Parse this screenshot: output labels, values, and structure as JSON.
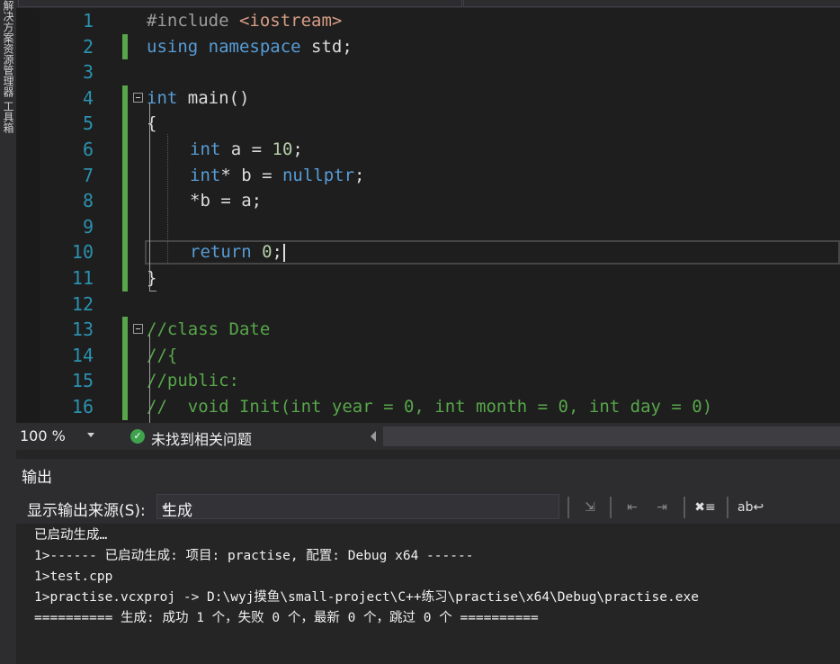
{
  "window": {
    "left_strip_text": "解决方案资源管理器 工具箱"
  },
  "editor": {
    "lines": [
      {
        "n": "1"
      },
      {
        "n": "2"
      },
      {
        "n": "3"
      },
      {
        "n": "4"
      },
      {
        "n": "5"
      },
      {
        "n": "6"
      },
      {
        "n": "7"
      },
      {
        "n": "8"
      },
      {
        "n": "9"
      },
      {
        "n": "10"
      },
      {
        "n": "11"
      },
      {
        "n": "12"
      },
      {
        "n": "13"
      },
      {
        "n": "14"
      },
      {
        "n": "15"
      },
      {
        "n": "16"
      }
    ],
    "code": {
      "l1_pre": "#include ",
      "l1_str": "<iostream>",
      "l2_kw": "using namespace",
      "l2_rest": " std;",
      "l4_kw": "int",
      "l4_rest": " main()",
      "l5": "{",
      "l6_kw": "int",
      "l6_mid": " a = ",
      "l6_num": "10",
      "l6_end": ";",
      "l7_kw": "int",
      "l7_mid": "* b = ",
      "l7_kw2": "nullptr",
      "l7_end": ";",
      "l8": "*b = a;",
      "l10_kw": "return",
      "l10_sp": " ",
      "l10_num": "0",
      "l10_end": ";",
      "l11": "}",
      "l13": "//class Date",
      "l14": "//{",
      "l15": "//public:",
      "l16": "//  void Init(int year = 0, int month = 0, int day = 0)"
    },
    "change_bar_color": "#57a64a"
  },
  "status": {
    "zoom": "100 %",
    "issues": "未找到相关问题"
  },
  "output": {
    "title": "输出",
    "source_label": "显示输出来源(S):",
    "source_value": "生成",
    "lines": [
      "已启动生成…",
      "1>------ 已启动生成: 项目: practise, 配置: Debug x64 ------",
      "1>test.cpp",
      "1>practise.vcxproj -> D:\\wyj摸鱼\\small-project\\C++练习\\practise\\x64\\Debug\\practise.exe",
      "========== 生成: 成功 1 个，失败 0 个，最新 0 个，跳过 0 个 =========="
    ]
  }
}
